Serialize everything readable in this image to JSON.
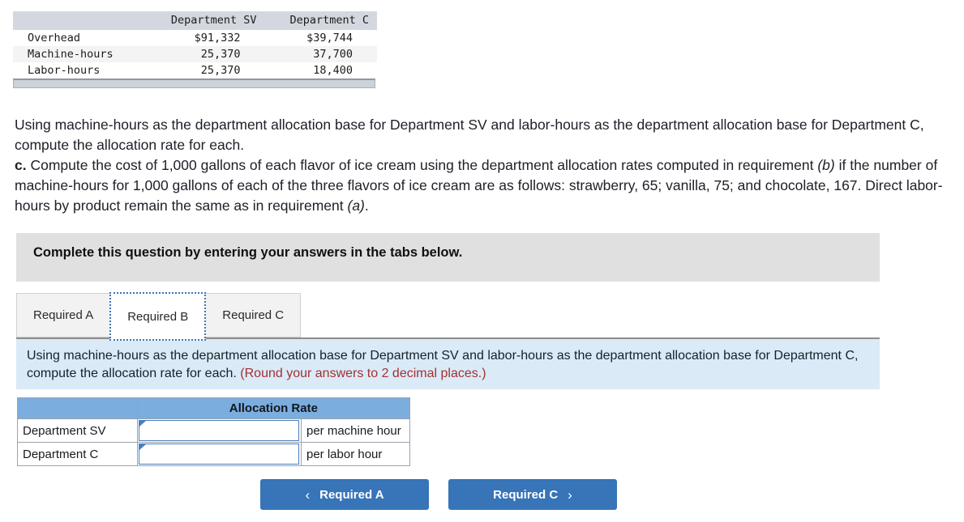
{
  "top_table": {
    "columns": [
      "",
      "Department SV",
      "Department C"
    ],
    "rows": [
      {
        "label": "Overhead",
        "sv": "$91,332",
        "c": "$39,744"
      },
      {
        "label": "Machine-hours",
        "sv": "25,370",
        "c": "37,700"
      },
      {
        "label": "Labor-hours",
        "sv": "25,370",
        "c": "18,400"
      }
    ]
  },
  "question": {
    "intro": "Using machine-hours as the department allocation base for Department SV and labor-hours as the department allocation base for Department C, compute the allocation rate for each.",
    "part_c_label": "c.",
    "part_c_text_1": "Compute the cost of 1,000 gallons of each flavor of ice cream using the department allocation rates computed in requirement",
    "part_c_ref_b": "(b)",
    "part_c_text_2": "if the number of machine-hours for 1,000 gallons of each of the three flavors of ice cream are as follows: strawberry, 65; vanilla, 75; and chocolate, 167. Direct labor-hours by product remain the same as in requirement",
    "part_c_ref_a": "(a)",
    "part_c_period": "."
  },
  "banner": {
    "text": "Complete this question by entering your answers in the tabs below."
  },
  "tabs": [
    {
      "label": "Required A",
      "active": false
    },
    {
      "label": "Required B",
      "active": true
    },
    {
      "label": "Required C",
      "active": false
    }
  ],
  "instruction": {
    "text": "Using machine-hours as the department allocation base for Department SV and labor-hours as the department allocation base for Department C, compute the allocation rate for each.",
    "rounding_note": "(Round your answers to 2 decimal places.)",
    "rounding_color": "#a33131"
  },
  "alloc_table": {
    "corner_header": "",
    "rate_header": "Allocation Rate",
    "rows": [
      {
        "name": "Department SV",
        "value": "",
        "unit": "per machine hour"
      },
      {
        "name": "Department C",
        "value": "",
        "unit": "per labor hour"
      }
    ]
  },
  "nav": {
    "prev_chevron": "‹",
    "prev_label": "Required A",
    "next_label": "Required C",
    "next_chevron": "›"
  },
  "colors": {
    "accent_blue": "#3774b8",
    "table_header_blue": "#7badde",
    "panel_blue": "#daeaf7",
    "banner_gray": "#e0e0e0",
    "input_border": "#4a7fc0"
  }
}
